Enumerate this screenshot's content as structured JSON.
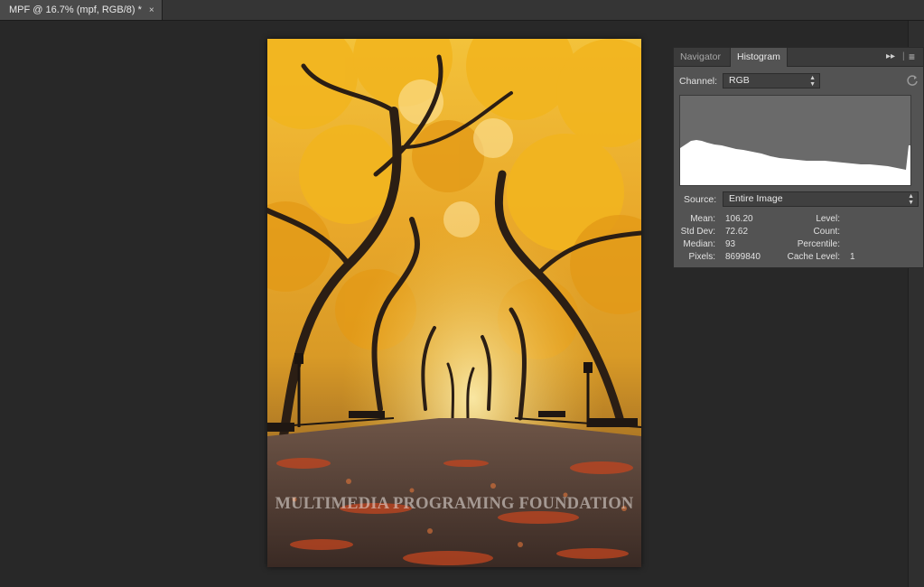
{
  "document_tab": {
    "title": "MPF @ 16.7% (mpf, RGB/8) *",
    "close_glyph": "×"
  },
  "image": {
    "watermark": "MULTIMEDIA PROGRAMING FOUNDATION"
  },
  "panel": {
    "tabs": [
      {
        "label": "Navigator"
      },
      {
        "label": "Histogram"
      }
    ],
    "active_tab": "Histogram",
    "collapse_glyph": "▸▸",
    "menu_glyph": "≡",
    "channel": {
      "label": "Channel:",
      "value": "RGB"
    },
    "refresh_icon": "refresh-icon",
    "source": {
      "label": "Source:",
      "value": "Entire Image"
    },
    "stats": {
      "mean": {
        "label": "Mean:",
        "value": "106.20"
      },
      "std_dev": {
        "label": "Std Dev:",
        "value": "72.62"
      },
      "median": {
        "label": "Median:",
        "value": "93"
      },
      "pixels": {
        "label": "Pixels:",
        "value": "8699840"
      },
      "level": {
        "label": "Level:",
        "value": ""
      },
      "count": {
        "label": "Count:",
        "value": ""
      },
      "percentile": {
        "label": "Percentile:",
        "value": ""
      },
      "cache_level": {
        "label": "Cache Level:",
        "value": "1"
      }
    }
  },
  "colors": {
    "workspace": "#282828",
    "panel": "#535353",
    "histogram_fill": "#ffffff"
  }
}
